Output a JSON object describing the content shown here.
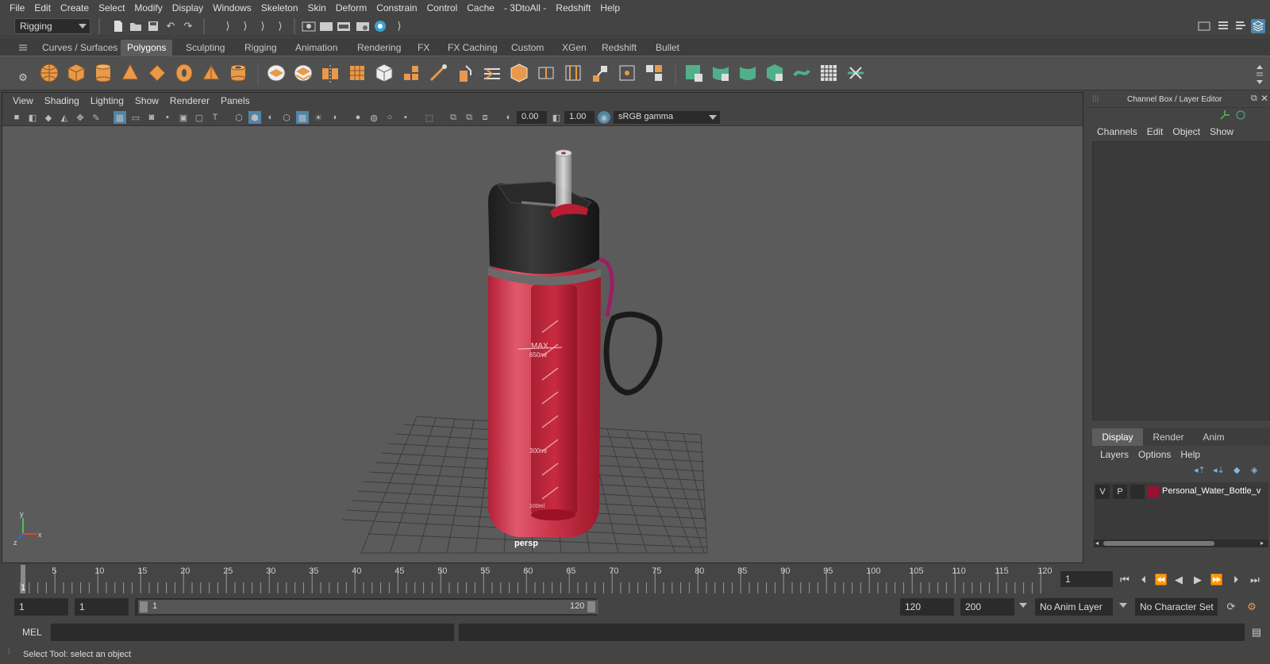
{
  "menubar": [
    "File",
    "Edit",
    "Create",
    "Select",
    "Modify",
    "Display",
    "Windows",
    "Skeleton",
    "Skin",
    "Deform",
    "Constrain",
    "Control",
    "Cache",
    "- 3DtoAll -",
    "Redshift",
    "Help"
  ],
  "statusline": {
    "mode": "Rigging"
  },
  "shelf_tabs": [
    "Curves / Surfaces",
    "Polygons",
    "Sculpting",
    "Rigging",
    "Animation",
    "Rendering",
    "FX",
    "FX Caching",
    "Custom",
    "XGen",
    "Redshift",
    "Bullet"
  ],
  "shelf_active_tab": "Polygons",
  "viewport": {
    "menu": [
      "View",
      "Shading",
      "Lighting",
      "Show",
      "Renderer",
      "Panels"
    ],
    "exposure": "0.00",
    "gamma": "1.00",
    "color_space": "sRGB gamma",
    "camera_label": "persp",
    "bottle_labels": {
      "max": "MAX",
      "m650": "650ml",
      "m300": "300ml",
      "m100": "100ml"
    }
  },
  "right_panel": {
    "title": "Channel Box / Layer Editor",
    "channel_menu": [
      "Channels",
      "Edit",
      "Object",
      "Show"
    ],
    "layer_tabs": [
      "Display",
      "Render",
      "Anim"
    ],
    "layer_active_tab": "Display",
    "layer_menu": [
      "Layers",
      "Options",
      "Help"
    ],
    "layer": {
      "v": "V",
      "p": "P",
      "name": "Personal_Water_Bottle_v",
      "color": "#9a1030"
    }
  },
  "timeline": {
    "ticks": [
      "5",
      "10",
      "15",
      "20",
      "25",
      "30",
      "35",
      "40",
      "45",
      "50",
      "55",
      "60",
      "65",
      "70",
      "75",
      "80",
      "85",
      "90",
      "95",
      "100",
      "105",
      "110",
      "115",
      "120"
    ],
    "current_frame_marker": "1",
    "current_frame": "1"
  },
  "range": {
    "start": "1",
    "playback_start": "1",
    "slider_start": "1",
    "slider_end": "120",
    "playback_end": "120",
    "end": "200",
    "anim_layer": "No Anim Layer",
    "character_set": "No Character Set"
  },
  "cmdline": {
    "label": "MEL"
  },
  "helpline": {
    "text": "Select Tool: select an object"
  },
  "colors": {
    "accent_blue": "#5285a6",
    "bottle_red": "#c8283e",
    "shelf_orange": "#e8994a",
    "shelf_green": "#4fb08a"
  }
}
